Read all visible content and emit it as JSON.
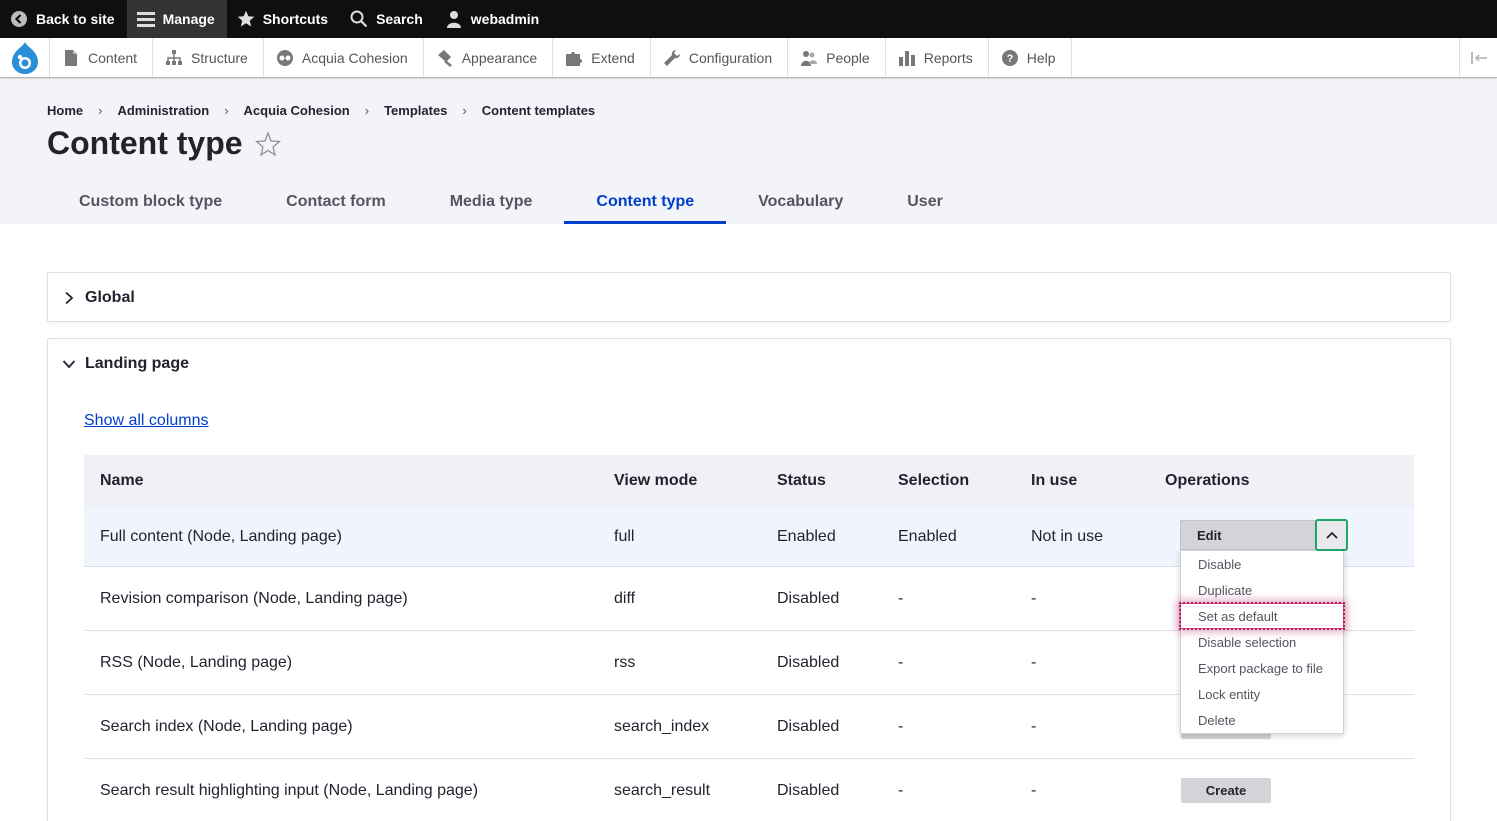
{
  "toolbar": {
    "back_to_site": "Back to site",
    "manage": "Manage",
    "shortcuts": "Shortcuts",
    "search": "Search",
    "user": "webadmin"
  },
  "admin_menu": {
    "items": [
      {
        "label": "Content",
        "icon": "file-icon"
      },
      {
        "label": "Structure",
        "icon": "sitemap-icon"
      },
      {
        "label": "Acquia Cohesion",
        "icon": "cohesion-icon"
      },
      {
        "label": "Appearance",
        "icon": "paint-icon"
      },
      {
        "label": "Extend",
        "icon": "puzzle-icon"
      },
      {
        "label": "Configuration",
        "icon": "wrench-icon"
      },
      {
        "label": "People",
        "icon": "people-icon"
      },
      {
        "label": "Reports",
        "icon": "bar-chart-icon"
      },
      {
        "label": "Help",
        "icon": "help-icon"
      }
    ]
  },
  "breadcrumb": [
    "Home",
    "Administration",
    "Acquia Cohesion",
    "Templates",
    "Content templates"
  ],
  "page": {
    "title": "Content type"
  },
  "tabs": [
    {
      "label": "Custom block type",
      "active": false
    },
    {
      "label": "Contact form",
      "active": false
    },
    {
      "label": "Media type",
      "active": false
    },
    {
      "label": "Content type",
      "active": true
    },
    {
      "label": "Vocabulary",
      "active": false
    },
    {
      "label": "User",
      "active": false
    }
  ],
  "sections": {
    "global": "Global",
    "landing": "Landing page",
    "show_all": "Show all columns"
  },
  "table": {
    "headers": [
      "Name",
      "View mode",
      "Status",
      "Selection",
      "In use",
      "Operations"
    ],
    "rows": [
      {
        "name": "Full content (Node, Landing page)",
        "view": "full",
        "status": "Enabled",
        "selection": "Enabled",
        "in_use": "Not in use"
      },
      {
        "name": "Revision comparison (Node, Landing page)",
        "view": "diff",
        "status": "Disabled",
        "selection": "-",
        "in_use": "-"
      },
      {
        "name": "RSS (Node, Landing page)",
        "view": "rss",
        "status": "Disabled",
        "selection": "-",
        "in_use": "-"
      },
      {
        "name": "Search index (Node, Landing page)",
        "view": "search_index",
        "status": "Disabled",
        "selection": "-",
        "in_use": "-"
      },
      {
        "name": "Search result highlighting input (Node, Landing page)",
        "view": "search_result",
        "status": "Disabled",
        "selection": "-",
        "in_use": "-"
      }
    ],
    "create_label": "Create"
  },
  "dropdown": {
    "edit": "Edit",
    "items": [
      "Disable",
      "Duplicate",
      "Set as default",
      "Disable selection",
      "Export package to file",
      "Lock entity",
      "Delete"
    ],
    "focused_index": 2
  },
  "colors": {
    "accent": "#003ecc",
    "focus_ring": "#1fa56a",
    "focused_item_outline": "#c2185b"
  }
}
